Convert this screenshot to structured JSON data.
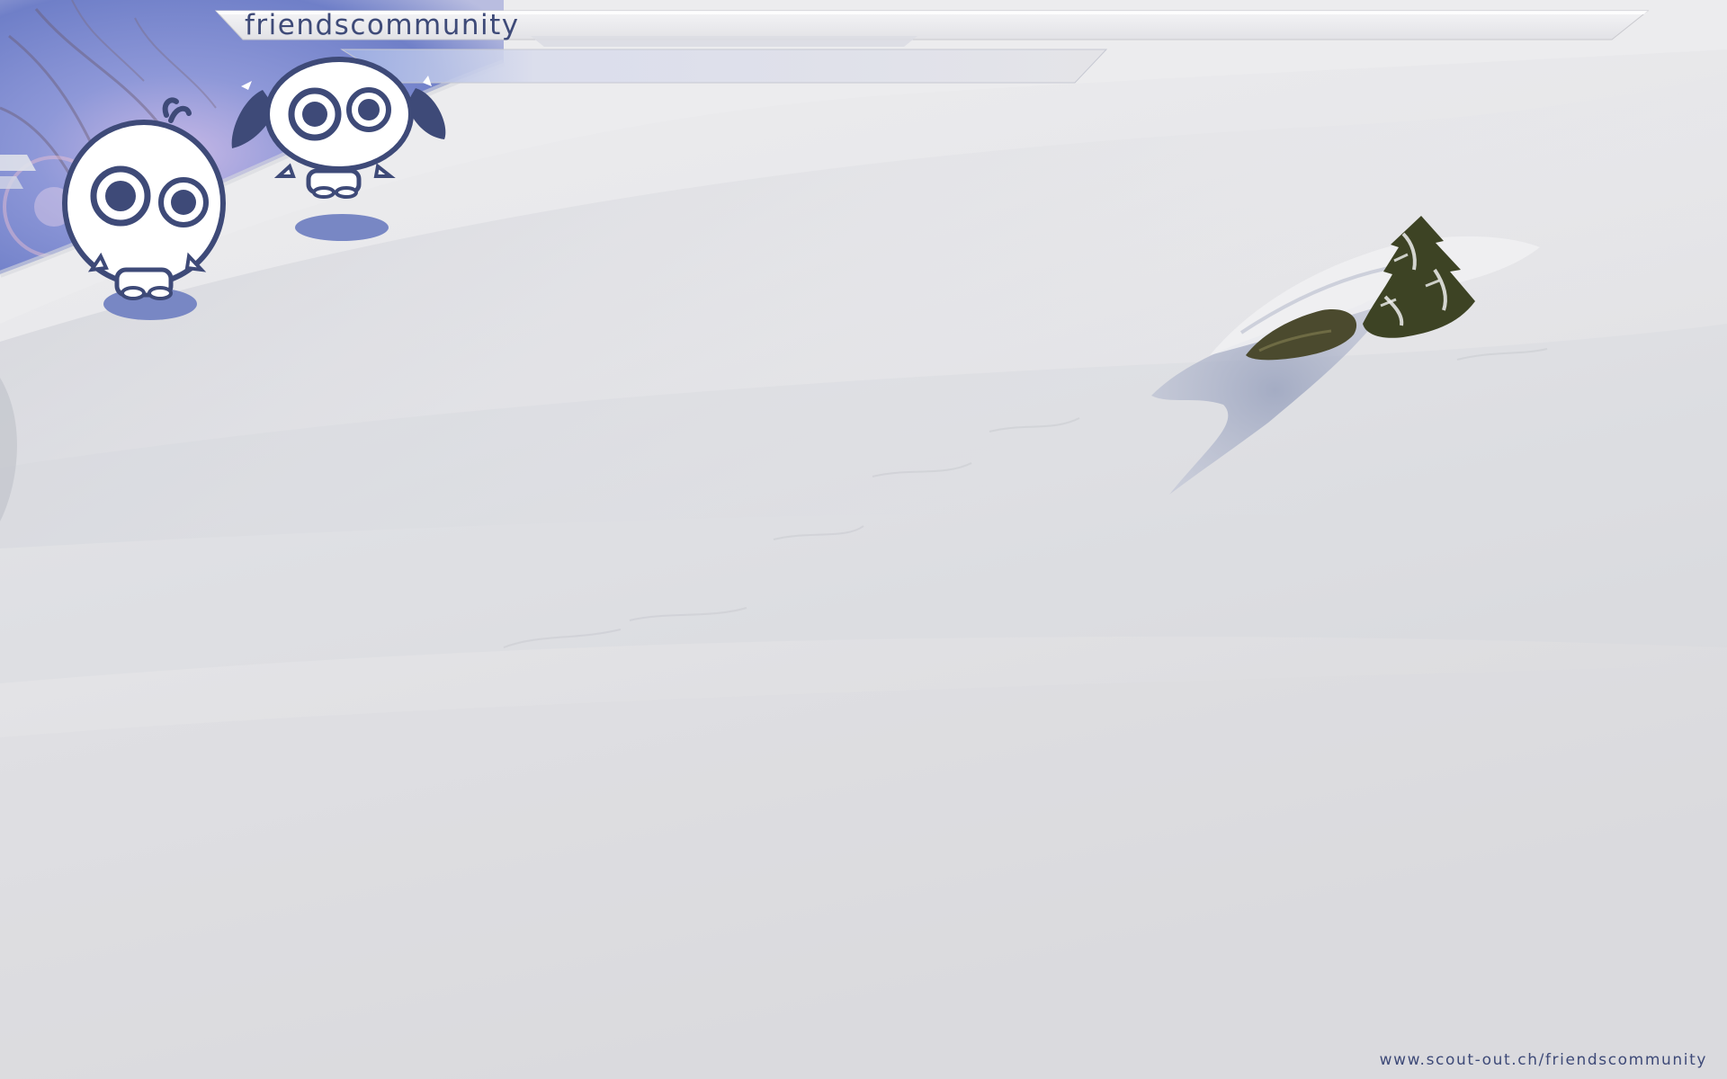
{
  "wallpaper": {
    "title": "friendscommunity",
    "url": "www.scout-out.ch/friendscommunity"
  },
  "colors": {
    "brand_navy": "#3e4a78",
    "snow": "#e8e8ea",
    "shadow_blue": "#a9b0c6",
    "sky_blue": "#7e8fd6"
  },
  "icons": [
    "boy-mascot-icon",
    "girl-mascot-icon",
    "small-fir-tree-icon"
  ]
}
